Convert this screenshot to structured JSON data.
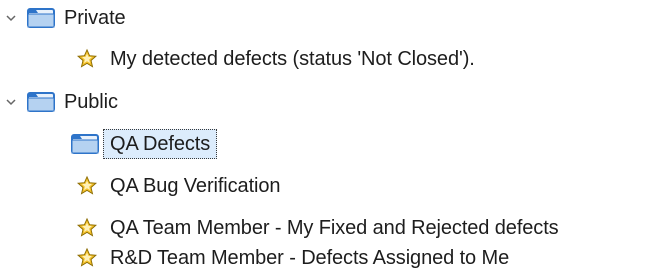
{
  "tree": {
    "private": {
      "label": "Private",
      "expanded": true,
      "items": [
        {
          "label": "My detected defects (status 'Not Closed').",
          "icon": "star-icon"
        }
      ]
    },
    "public": {
      "label": "Public",
      "expanded": true,
      "items": [
        {
          "label": "QA Defects",
          "icon": "folder-icon",
          "selected": true
        },
        {
          "label": "QA Bug Verification",
          "icon": "star-icon"
        },
        {
          "label": "QA Team Member - My Fixed and Rejected defects",
          "icon": "star-icon"
        },
        {
          "label": "R&D Team Member - Defects Assigned to Me",
          "icon": "star-icon"
        }
      ]
    }
  },
  "colors": {
    "selection_background": "#dcecfc",
    "star_fill": "#f3c12b",
    "folder_blue": "#2e74c9"
  }
}
